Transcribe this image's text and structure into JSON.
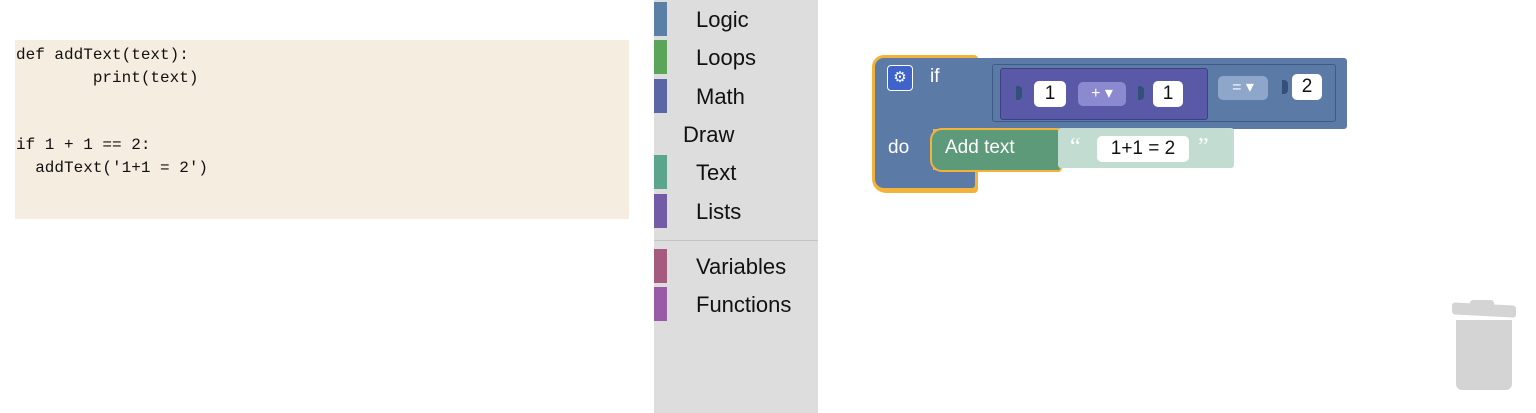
{
  "code": {
    "lines": [
      "def addText(text):",
      "        print(text)",
      "",
      "",
      "if 1 + 1 == 2:",
      "  addText('1+1 = 2')"
    ]
  },
  "toolbox": {
    "items": [
      {
        "label": "Logic",
        "color": "#5b80a5"
      },
      {
        "label": "Loops",
        "color": "#5ba55b"
      },
      {
        "label": "Math",
        "color": "#5b67a5"
      },
      {
        "label": "Draw",
        "color": ""
      },
      {
        "label": "Text",
        "color": "#5ba58c"
      },
      {
        "label": "Lists",
        "color": "#745ba5"
      },
      {
        "label": "Variables",
        "color": "#a55b80"
      },
      {
        "label": "Functions",
        "color": "#995ba5"
      }
    ]
  },
  "workspace": {
    "if_block": {
      "if_label": "if",
      "do_label": "do",
      "gear_icon": "gear-icon"
    },
    "compare": {
      "left_operand": "1",
      "arith_operator": "+",
      "right_operand": "1",
      "compare_operator": "=",
      "compare_value": "2"
    },
    "add_text_block": {
      "label": "Add text",
      "open_quote": "“",
      "text_value": "1+1 = 2",
      "close_quote": "”"
    },
    "trash_icon": "trash-icon"
  },
  "colors": {
    "logic": "#5b7ba6",
    "math": "#5a59a8",
    "text": "#5c9a7a",
    "highlight": "#f3b23a",
    "code_bg": "#f4ede0"
  }
}
